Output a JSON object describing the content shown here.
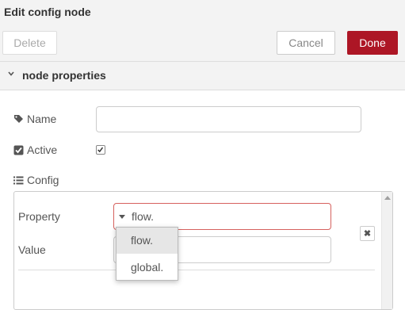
{
  "dialog": {
    "title": "Edit config node"
  },
  "toolbar": {
    "delete_label": "Delete",
    "cancel_label": "Cancel",
    "done_label": "Done"
  },
  "section": {
    "label": "node properties",
    "icon": "chevron-down-icon"
  },
  "fields": {
    "name": {
      "label": "Name",
      "icon": "tag-icon",
      "value": ""
    },
    "active": {
      "label": "Active",
      "icon": "checkbox-icon",
      "checked": true
    },
    "config": {
      "label": "Config",
      "icon": "list-icon"
    }
  },
  "config_row": {
    "property_label": "Property",
    "property_type_prefix": "flow.",
    "property_value": "",
    "value_label": "Value",
    "value": "",
    "remove_icon": "close-icon"
  },
  "dropdown": {
    "options": [
      {
        "label": "flow.",
        "selected": true
      },
      {
        "label": "global.",
        "selected": false
      }
    ]
  },
  "colors": {
    "accent": "#ad1625",
    "error_border": "#d6615e"
  }
}
